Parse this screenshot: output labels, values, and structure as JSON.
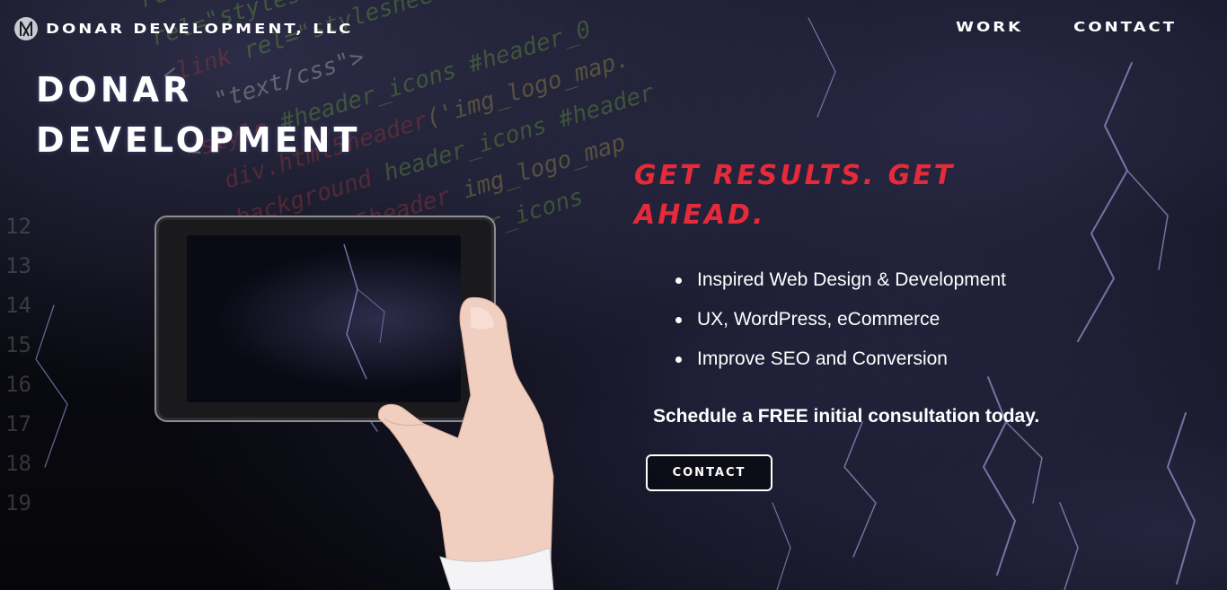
{
  "header": {
    "brand_name": "DONAR DEVELOPMENT, LLC",
    "logo_icon": "donar-logo-icon",
    "nav": [
      {
        "label": "WORK"
      },
      {
        "label": "CONTACT"
      }
    ]
  },
  "hero": {
    "title_line1": "DONAR",
    "title_line2": "DEVELOPMENT",
    "image": "hand-holding-tablet"
  },
  "main": {
    "tagline": "GET RESULTS. GET AHEAD.",
    "features": [
      "Inspired Web Design & Development",
      "UX, WordPress, eCommerce",
      "Improve SEO and Conversion"
    ],
    "cta_text": "Schedule a FREE initial consultation today.",
    "contact_button": "CONTACT"
  },
  "colors": {
    "accent": "#e52a3a",
    "text": "#ffffff",
    "background": "#07070c"
  }
}
